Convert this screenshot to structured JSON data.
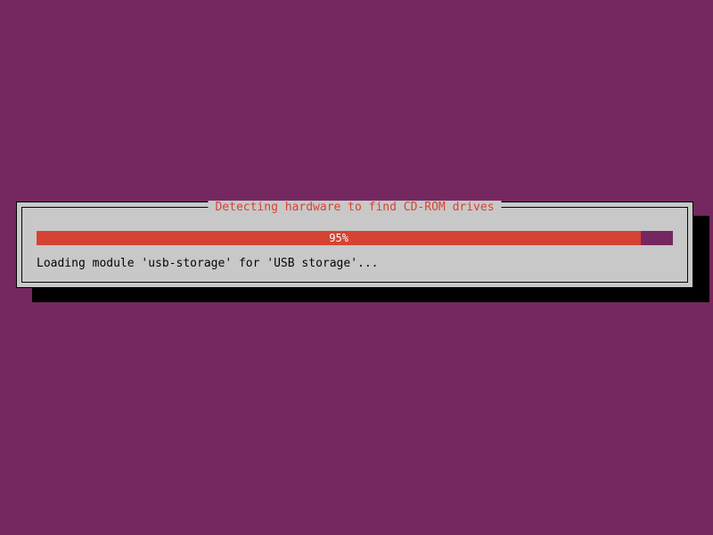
{
  "dialog": {
    "title": "Detecting hardware to find CD-ROM drives",
    "progress_percent": 95,
    "progress_label": "95%",
    "status_text": "Loading module 'usb-storage' for 'USB storage'..."
  },
  "colors": {
    "background": "#75285f",
    "dialog_bg": "#c8c8c8",
    "accent": "#d54332",
    "text": "#050505"
  }
}
